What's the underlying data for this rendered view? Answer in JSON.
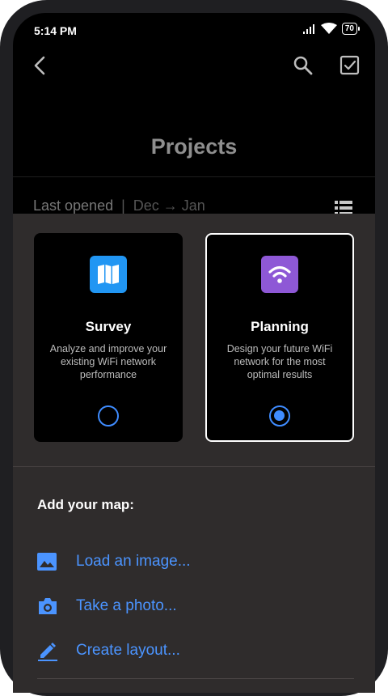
{
  "status_bar": {
    "time": "5:14 PM",
    "battery": "70",
    "icons": [
      "signal-icon",
      "wifi-icon",
      "battery-icon"
    ]
  },
  "toolbar": {
    "icons": [
      "back-arrow-icon",
      "search-icon",
      "checkbox-icon"
    ]
  },
  "page": {
    "title": "Projects"
  },
  "filter": {
    "sort_label": "Last opened",
    "separator": "|",
    "range_label": "Dec → Jan"
  },
  "project_types": [
    {
      "name": "Survey",
      "description": "Analyze and improve your existing WiFi network performance",
      "icon": "map-icon",
      "icon_color": "#2196f3",
      "selected": false
    },
    {
      "name": "Planning",
      "description": "Design your future WiFi network for the most optimal results",
      "icon": "wifi-icon",
      "icon_color": "#8e58d6",
      "selected": true
    }
  ],
  "add_map": {
    "heading": "Add your map:",
    "actions": [
      {
        "label": "Load an image...",
        "icon": "image-icon"
      },
      {
        "label": "Take a photo...",
        "icon": "camera-icon"
      },
      {
        "label": "Create layout...",
        "icon": "pencil-icon"
      }
    ]
  },
  "colors": {
    "accent": "#4b94ff",
    "sheet_background": "#2f2c2c",
    "screen_background": "#000000"
  }
}
